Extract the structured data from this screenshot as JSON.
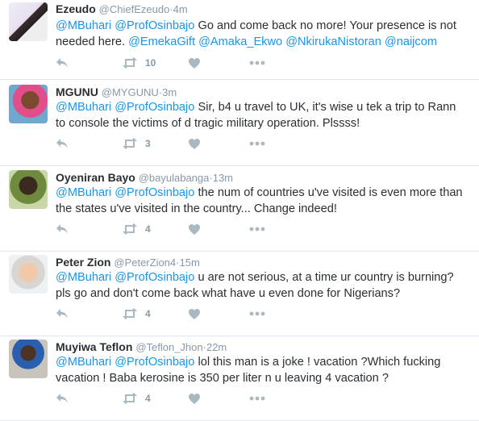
{
  "tweets": [
    {
      "name": "Ezeudo",
      "handle": "@ChiefEzeudo",
      "sep": "·",
      "time": "4m",
      "parts": [
        "",
        "@MBuhari",
        " ",
        "@ProfOsinbajo",
        "  Go and come back no more! Your presence is not needed here. ",
        "@EmekaGift",
        " ",
        "@Amaka_Ekwo",
        " ",
        "@NkirukaNistoran",
        " ",
        "@naijcom"
      ],
      "retweets": "10"
    },
    {
      "name": "MGUNU",
      "handle": "@MYGUNU",
      "sep": "·",
      "time": "3m",
      "parts": [
        "",
        "@MBuhari",
        " ",
        "@ProfOsinbajo",
        " Sir, b4 u travel to UK, it's wise u tek a trip to Rann to console the victims of d tragic military operation. Plssss!"
      ],
      "retweets": "3"
    },
    {
      "name": "Oyeniran Bayo",
      "handle": "@bayulabanga",
      "sep": "·",
      "time": "13m",
      "parts": [
        "",
        "@MBuhari",
        " ",
        "@ProfOsinbajo",
        " the num of countries u've visited is even more than the states u've visited in the country... Change indeed!"
      ],
      "retweets": "4"
    },
    {
      "name": "Peter Zion",
      "handle": "@PeterZion4",
      "sep": "·",
      "time": "15m",
      "parts": [
        "",
        "@MBuhari",
        " ",
        "@ProfOsinbajo",
        " u are not serious, at a time ur country is burning? pls go and don't come back what have u even done for Nigerians?"
      ],
      "retweets": "4"
    },
    {
      "name": "Muyiwa Teflon",
      "handle": "@Teflon_Jhon",
      "sep": "·",
      "time": "22m",
      "parts": [
        "",
        "@MBuhari",
        " ",
        "@ProfOsinbajo",
        " lol this man is a joke ! vacation ?Which fucking vacation ! Baba kerosine is 350 per liter n u leaving 4 vacation ?"
      ],
      "retweets": "4"
    }
  ],
  "colors": {
    "mention": "#1b95e0",
    "icon": "#aab8c2",
    "meta": "#8899a6",
    "border": "#e1e8ed"
  },
  "icons": [
    "reply-icon",
    "retweet-icon",
    "like-heart-icon",
    "more-dots-icon"
  ]
}
